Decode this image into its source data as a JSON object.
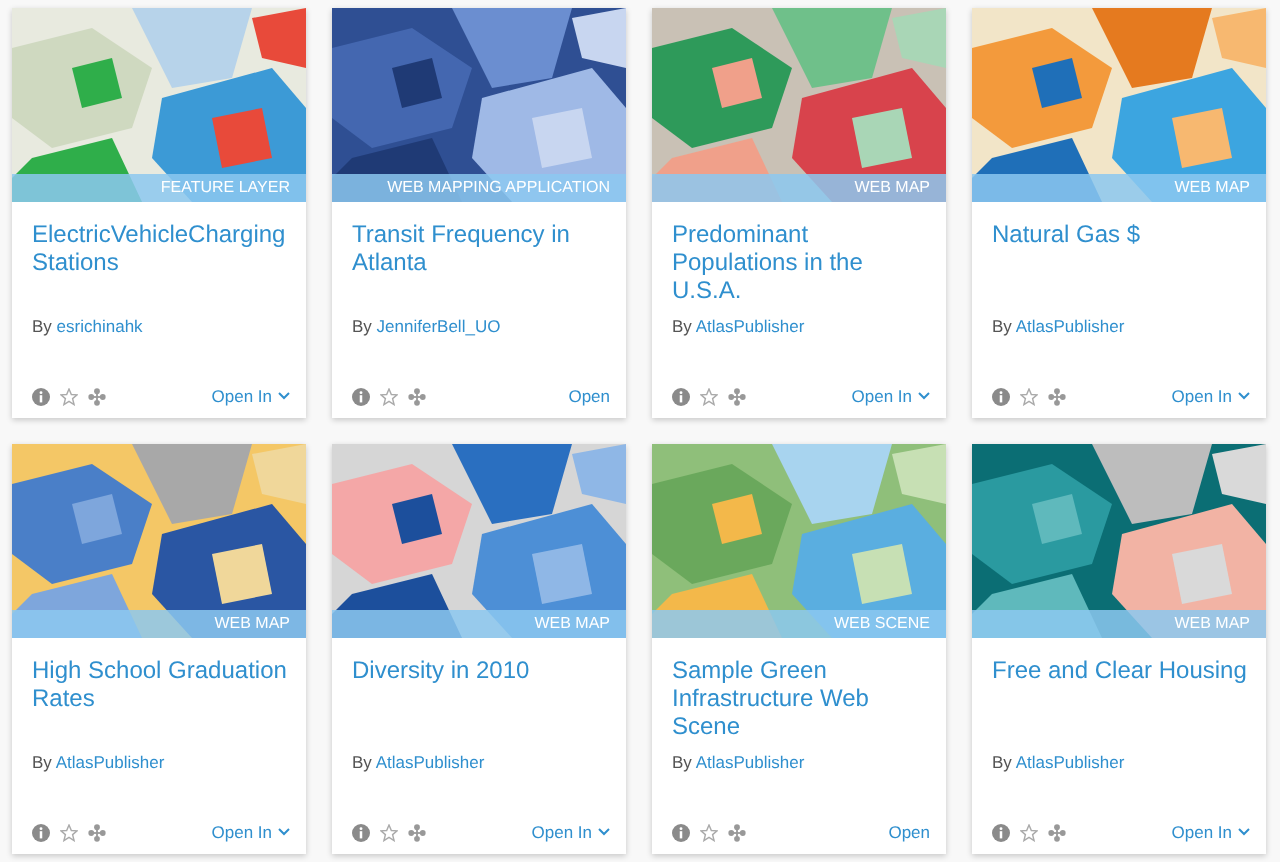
{
  "cards": [
    {
      "item_type": "FEATURE LAYER",
      "title": "ElectricVehicleChargingStations",
      "by": "By",
      "author": "esrichinahk",
      "action": "Open In",
      "kind": "menu"
    },
    {
      "item_type": "WEB MAPPING APPLICATION",
      "title": "Transit Frequency in Atlanta",
      "by": "By",
      "author": "JenniferBell_UO",
      "action": "Open",
      "kind": "link"
    },
    {
      "item_type": "WEB MAP",
      "title": "Predominant Populations in the U.S.A.",
      "by": "By",
      "author": "AtlasPublisher",
      "action": "Open In",
      "kind": "menu"
    },
    {
      "item_type": "WEB MAP",
      "title": "Natural Gas $",
      "by": "By",
      "author": "AtlasPublisher",
      "action": "Open In",
      "kind": "menu"
    },
    {
      "item_type": "WEB MAP",
      "title": "High School Graduation Rates",
      "by": "By",
      "author": "AtlasPublisher",
      "action": "Open In",
      "kind": "menu"
    },
    {
      "item_type": "WEB MAP",
      "title": "Diversity in 2010",
      "by": "By",
      "author": "AtlasPublisher",
      "action": "Open In",
      "kind": "menu"
    },
    {
      "item_type": "WEB SCENE",
      "title": "Sample Green Infrastructure Web Scene",
      "by": "By",
      "author": "AtlasPublisher",
      "action": "Open",
      "kind": "link"
    },
    {
      "item_type": "WEB MAP",
      "title": "Free and Clear Housing",
      "by": "By",
      "author": "AtlasPublisher",
      "action": "Open In",
      "kind": "menu"
    }
  ]
}
